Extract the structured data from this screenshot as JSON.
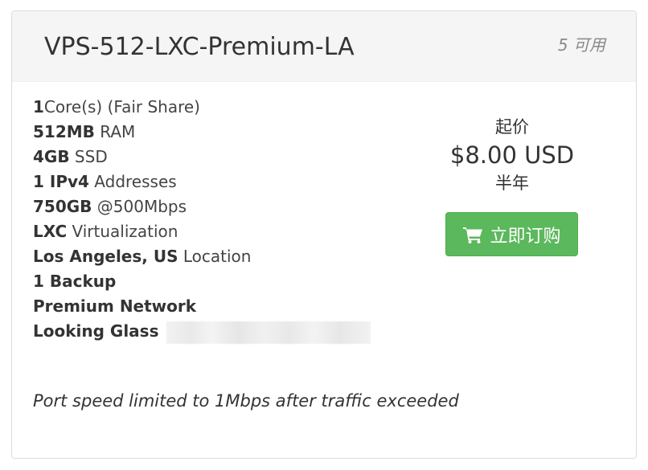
{
  "product": {
    "name": "VPS-512-LXC-Premium-LA",
    "availability": "5 可用"
  },
  "features": [
    {
      "bold": "1",
      "text": "Core(s) (Fair Share)"
    },
    {
      "bold": "512MB",
      "text": " RAM"
    },
    {
      "bold": "4GB",
      "text": " SSD"
    },
    {
      "bold": "1 IPv4",
      "text": " Addresses"
    },
    {
      "bold": "750GB",
      "text": " @500Mbps"
    },
    {
      "bold": "LXC",
      "text": " Virtualization"
    },
    {
      "bold": "Los Angeles, US",
      "text": " Location"
    },
    {
      "bold": "1 Backup",
      "text": ""
    },
    {
      "bold": "Premium Network",
      "text": ""
    },
    {
      "bold": "Looking Glass",
      "text": " "
    }
  ],
  "pricing": {
    "from_label": "起价",
    "price": "$8.00 USD",
    "cycle": "半年"
  },
  "order_button": {
    "label": "立即订购",
    "icon": "cart-icon",
    "color": "#5cb85c"
  },
  "note": "Port speed limited to 1Mbps after traffic exceeded"
}
